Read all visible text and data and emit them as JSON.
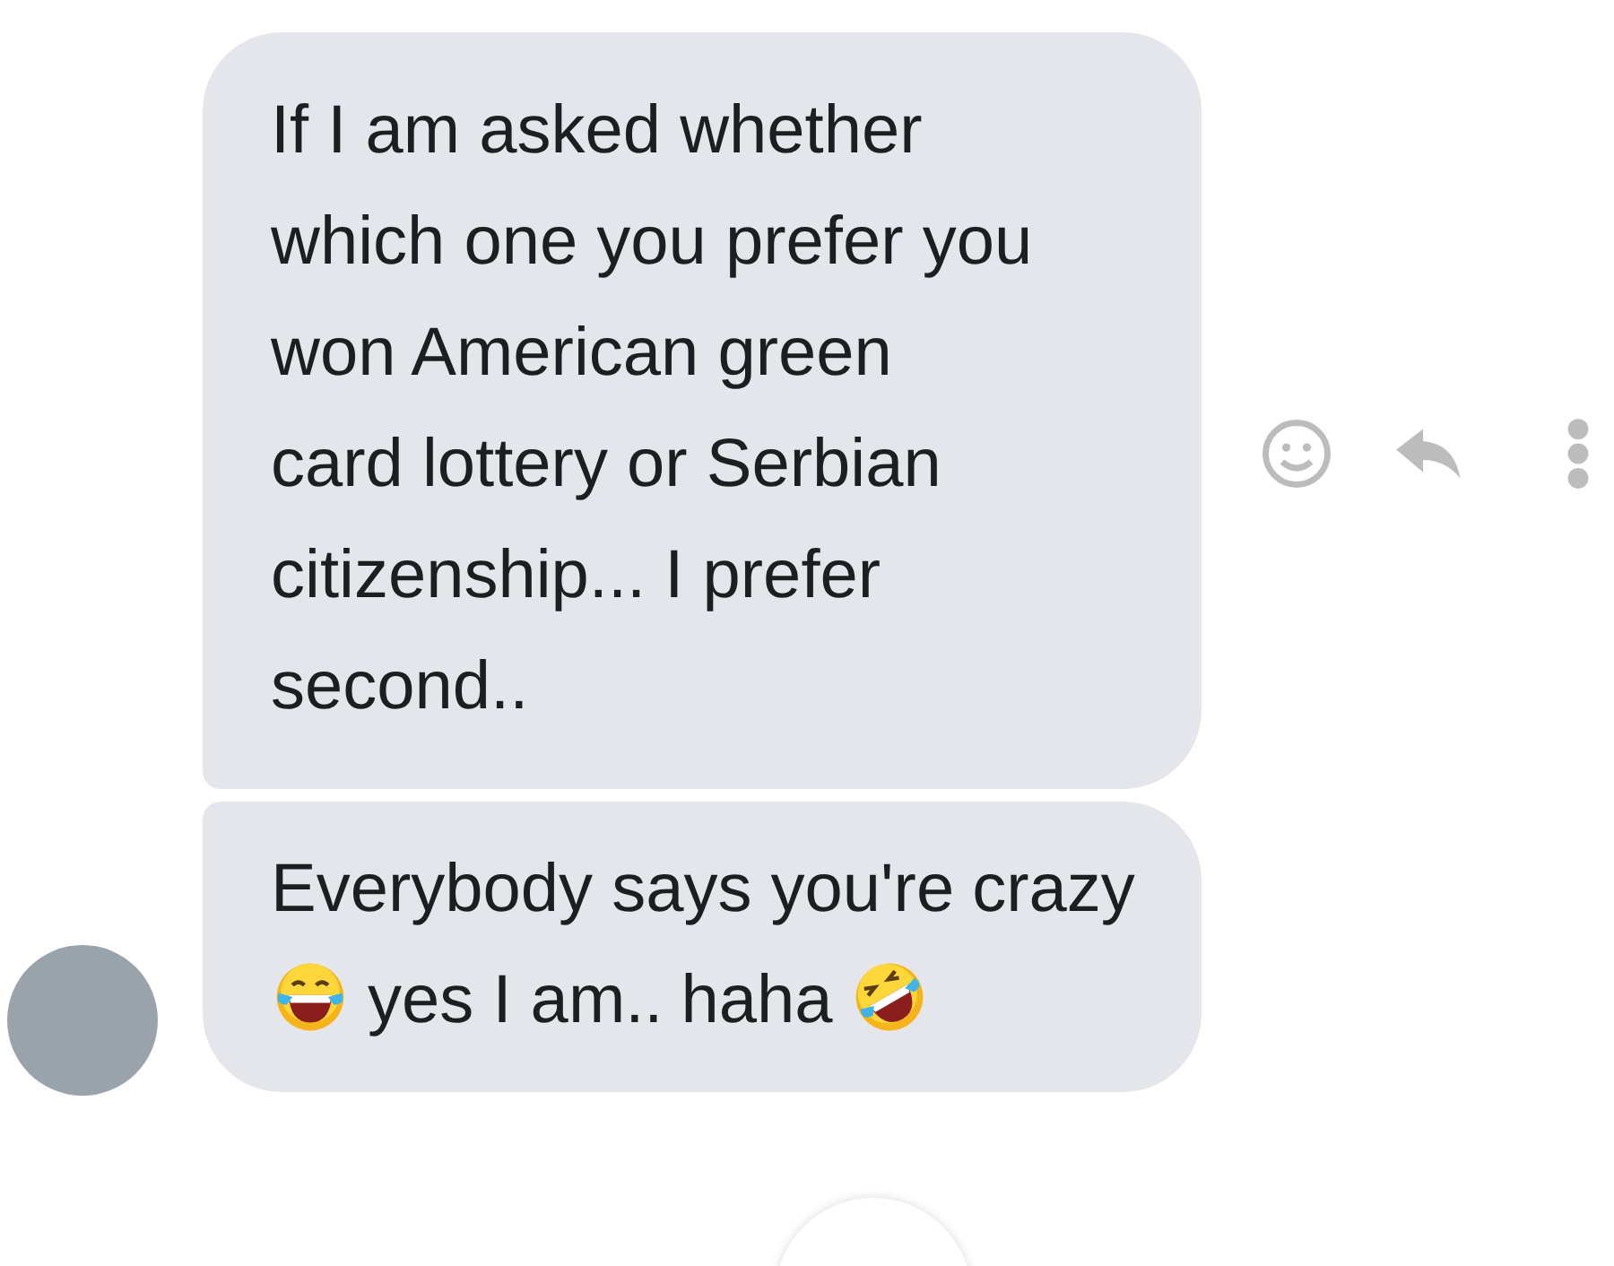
{
  "messages": [
    {
      "segments": [
        {
          "kind": "text",
          "text": "If I am asked whether which one you prefer you won American green card lottery or Serbian citizenship... I prefer second.."
        }
      ],
      "show_actions": true,
      "show_avatar": false
    },
    {
      "segments": [
        {
          "kind": "text",
          "text": "Everybody says you're"
        },
        {
          "kind": "text",
          "text": "crazy"
        },
        {
          "kind": "joy-emoji"
        },
        {
          "kind": "text",
          "text": "yes I am.."
        },
        {
          "kind": "text",
          "text": "haha"
        },
        {
          "kind": "rofl-emoji"
        }
      ],
      "show_actions": false,
      "show_avatar": true
    }
  ]
}
